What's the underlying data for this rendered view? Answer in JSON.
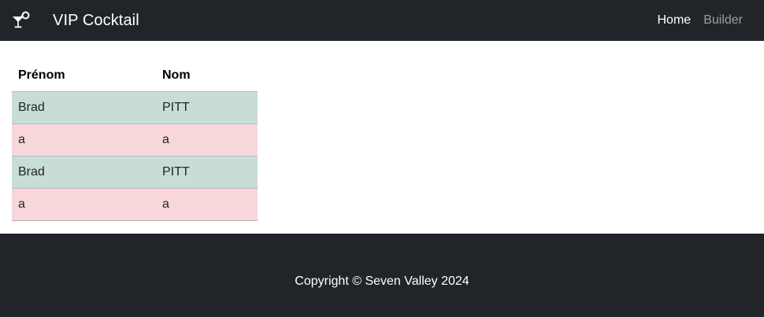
{
  "navbar": {
    "brand_icon": "cocktail-glass-icon",
    "brand_text": "VIP Cocktail",
    "links": [
      {
        "label": "Home",
        "active": true
      },
      {
        "label": "Builder",
        "active": false
      }
    ]
  },
  "table": {
    "headers": [
      "Prénom",
      "Nom"
    ],
    "rows": [
      {
        "prenom": "Brad",
        "nom": "PITT",
        "status": "success"
      },
      {
        "prenom": "a",
        "nom": "a",
        "status": "danger"
      },
      {
        "prenom": "Brad",
        "nom": "PITT",
        "status": "success"
      },
      {
        "prenom": "a",
        "nom": "a",
        "status": "danger"
      }
    ]
  },
  "footer": {
    "text": "Copyright © Seven Valley 2024"
  },
  "colors": {
    "navbar_bg": "#212529",
    "row_success": "#c8ddd6",
    "row_danger": "#f7d7da"
  }
}
